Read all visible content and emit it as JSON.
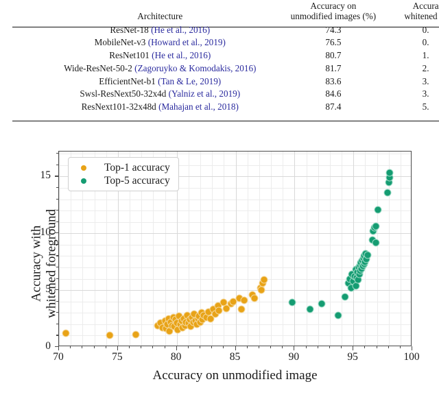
{
  "table": {
    "headers": [
      {
        "lines": [
          "Architecture"
        ]
      },
      {
        "lines": [
          "Accuracy on",
          "unmodified images (%)"
        ]
      },
      {
        "lines": [
          "Accura",
          "whitened fo"
        ]
      }
    ],
    "rows": [
      {
        "model": "ResNet-18",
        "citation": "(He et al., 2016)",
        "acc_unmodified": "74.3",
        "acc_whitened": "0."
      },
      {
        "model": "MobileNet-v3",
        "citation": "(Howard et al., 2019)",
        "acc_unmodified": "76.5",
        "acc_whitened": "0."
      },
      {
        "model": "ResNet101",
        "citation": "(He et al., 2016)",
        "acc_unmodified": "80.7",
        "acc_whitened": "1."
      },
      {
        "model": "Wide-ResNet-50-2",
        "citation": "(Zagoruyko & Komodakis, 2016)",
        "acc_unmodified": "81.7",
        "acc_whitened": "2."
      },
      {
        "model": "EfficientNet-b1",
        "citation": "(Tan & Le, 2019)",
        "acc_unmodified": "83.6",
        "acc_whitened": "3."
      },
      {
        "model": "Swsl-ResNext50-32x4d",
        "citation": "(Yalniz et al., 2019)",
        "acc_unmodified": "84.6",
        "acc_whitened": "3."
      },
      {
        "model": "ResNext101-32x48d",
        "citation": "(Mahajan et al., 2018)",
        "acc_unmodified": "87.4",
        "acc_whitened": "5."
      }
    ],
    "citation_color": "#2a2a9e"
  },
  "chart_data": {
    "type": "scatter",
    "title": "",
    "xlabel": "Accuracy on unmodified image",
    "ylabel": "Accuracy with\nwhitened foreground",
    "ylabel_lines": [
      "Accuracy with",
      "whitened foreground"
    ],
    "xlim": [
      70,
      100
    ],
    "ylim": [
      0,
      17.2
    ],
    "xticks": [
      70,
      75,
      80,
      85,
      90,
      95,
      100
    ],
    "xticklabels": [
      "70",
      "75",
      "80",
      "85",
      "90",
      "95",
      "100"
    ],
    "yticks": [
      0,
      5,
      10,
      15
    ],
    "yticklabels": [
      "0",
      "5",
      "10",
      "15"
    ],
    "x_minor_step": 1,
    "y_minor_step": 1,
    "grid": true,
    "grid_major_color": "#d8d8d8",
    "grid_minor_color": "#ececec",
    "legend_position": "upper left",
    "marker_size_px": 11,
    "series": [
      {
        "name": "Top-1 accuracy",
        "color": "#e8a317",
        "points": [
          [
            70.6,
            1.2
          ],
          [
            74.3,
            1.0
          ],
          [
            76.5,
            1.1
          ],
          [
            78.4,
            1.9
          ],
          [
            78.6,
            2.1
          ],
          [
            78.8,
            1.7
          ],
          [
            79.0,
            2.3
          ],
          [
            79.1,
            1.6
          ],
          [
            79.2,
            2.0
          ],
          [
            79.3,
            2.5
          ],
          [
            79.4,
            1.4
          ],
          [
            79.5,
            2.2
          ],
          [
            79.6,
            1.9
          ],
          [
            79.7,
            2.6
          ],
          [
            79.8,
            1.8
          ],
          [
            79.9,
            2.4
          ],
          [
            80.0,
            2.1
          ],
          [
            80.1,
            1.5
          ],
          [
            80.2,
            2.7
          ],
          [
            80.3,
            2.0
          ],
          [
            80.4,
            2.3
          ],
          [
            80.5,
            1.7
          ],
          [
            80.6,
            2.5
          ],
          [
            80.7,
            1.9
          ],
          [
            80.8,
            2.2
          ],
          [
            80.9,
            2.8
          ],
          [
            81.0,
            2.1
          ],
          [
            81.1,
            2.4
          ],
          [
            81.2,
            1.8
          ],
          [
            81.3,
            2.6
          ],
          [
            81.4,
            2.2
          ],
          [
            81.5,
            2.9
          ],
          [
            81.6,
            2.3
          ],
          [
            81.7,
            2.0
          ],
          [
            81.8,
            2.5
          ],
          [
            81.9,
            2.7
          ],
          [
            82.0,
            2.2
          ],
          [
            82.1,
            3.0
          ],
          [
            82.2,
            2.4
          ],
          [
            82.3,
            2.8
          ],
          [
            82.5,
            2.6
          ],
          [
            82.7,
            3.1
          ],
          [
            82.9,
            2.5
          ],
          [
            83.1,
            3.3
          ],
          [
            83.3,
            2.9
          ],
          [
            83.5,
            3.6
          ],
          [
            83.6,
            3.2
          ],
          [
            84.0,
            3.9
          ],
          [
            84.2,
            3.4
          ],
          [
            84.6,
            3.8
          ],
          [
            84.8,
            4.0
          ],
          [
            85.3,
            4.3
          ],
          [
            85.5,
            3.3
          ],
          [
            85.7,
            4.1
          ],
          [
            86.4,
            4.6
          ],
          [
            86.6,
            4.3
          ],
          [
            87.1,
            5.2
          ],
          [
            87.3,
            5.6
          ],
          [
            87.4,
            5.9
          ],
          [
            87.2,
            5.0
          ]
        ]
      },
      {
        "name": "Top-5 accuracy",
        "color": "#159c72",
        "points": [
          [
            89.8,
            3.9
          ],
          [
            91.3,
            3.3
          ],
          [
            92.3,
            3.8
          ],
          [
            93.7,
            2.8
          ],
          [
            94.3,
            4.4
          ],
          [
            94.6,
            5.6
          ],
          [
            94.7,
            6.0
          ],
          [
            94.8,
            5.2
          ],
          [
            94.9,
            6.4
          ],
          [
            95.0,
            5.8
          ],
          [
            95.1,
            6.2
          ],
          [
            95.2,
            5.4
          ],
          [
            95.25,
            6.8
          ],
          [
            95.3,
            6.1
          ],
          [
            95.35,
            6.6
          ],
          [
            95.4,
            5.9
          ],
          [
            95.45,
            7.0
          ],
          [
            95.5,
            6.4
          ],
          [
            95.55,
            7.2
          ],
          [
            95.6,
            6.7
          ],
          [
            95.65,
            7.4
          ],
          [
            95.7,
            6.9
          ],
          [
            95.75,
            7.6
          ],
          [
            95.8,
            7.1
          ],
          [
            95.85,
            7.8
          ],
          [
            95.9,
            7.3
          ],
          [
            95.95,
            8.0
          ],
          [
            96.0,
            7.5
          ],
          [
            96.05,
            8.2
          ],
          [
            96.1,
            7.7
          ],
          [
            96.2,
            8.1
          ],
          [
            96.6,
            9.4
          ],
          [
            96.9,
            9.2
          ],
          [
            96.7,
            10.2
          ],
          [
            96.8,
            10.5
          ],
          [
            96.9,
            10.6
          ],
          [
            97.1,
            12.1
          ],
          [
            97.9,
            13.6
          ],
          [
            98.0,
            14.5
          ],
          [
            98.05,
            14.9
          ],
          [
            98.1,
            15.3
          ]
        ]
      }
    ],
    "legend": [
      {
        "label": "Top-1 accuracy",
        "color": "#e8a317"
      },
      {
        "label": "Top-5 accuracy",
        "color": "#159c72"
      }
    ]
  }
}
